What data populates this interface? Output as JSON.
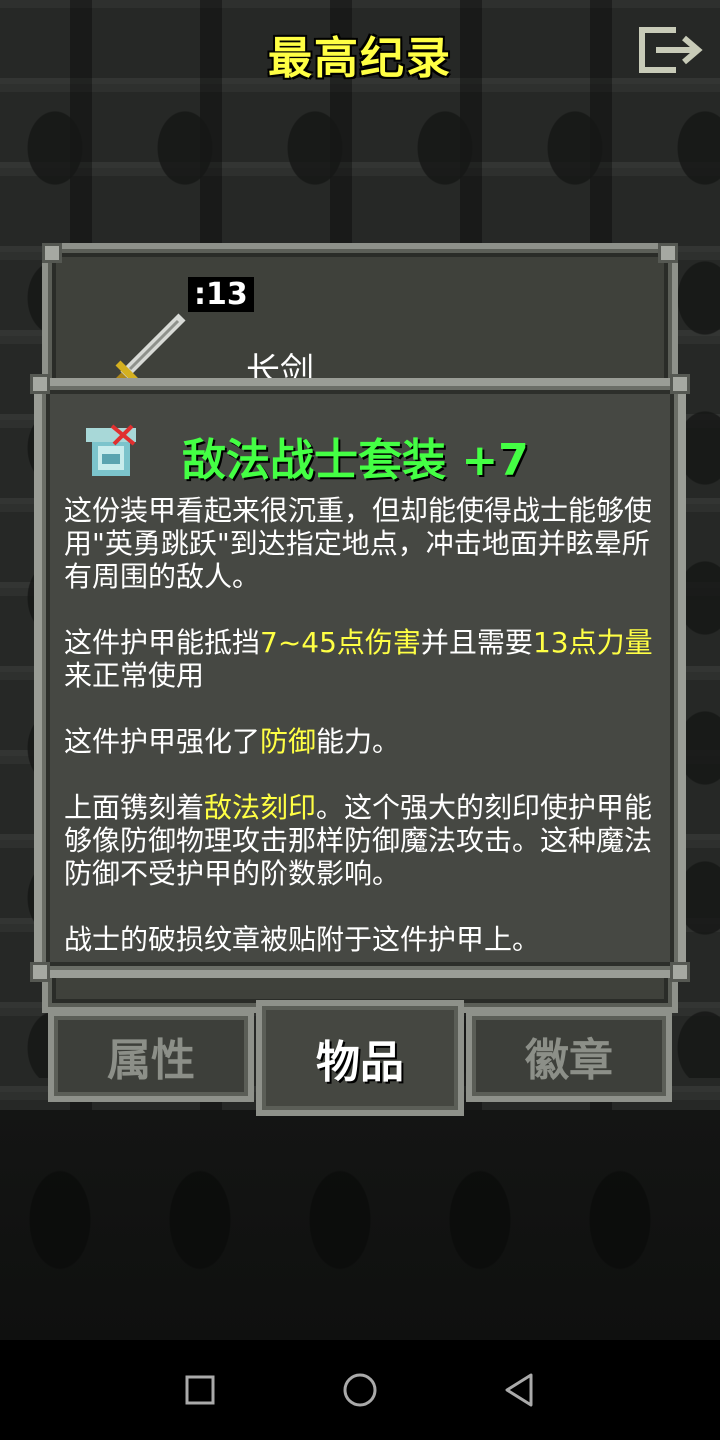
{
  "header": {
    "title": "最高纪录",
    "exit_icon": "exit-door-icon"
  },
  "item": {
    "level": ":13",
    "name": "长剑",
    "icon": "sword-icon"
  },
  "info": {
    "icon": "armor-icon",
    "title": "敌法战士套装 +7",
    "p1": "这份装甲看起来很沉重，但却能使得战士能够使用\"英勇跳跃\"到达指定地点，冲击地面并眩晕所有周围的敌人。",
    "p2_a": "这件护甲能抵挡",
    "p2_b": "7~45点伤害",
    "p2_c": "并且需要",
    "p2_d": "13点力量",
    "p2_e": "来正常使用",
    "p3_a": "这件护甲强化了",
    "p3_b": "防御",
    "p3_c": "能力。",
    "p4_a": "上面镌刻着",
    "p4_b": "敌法刻印",
    "p4_c": "。这个强大的刻印使护甲能够像防御物理攻击那样防御魔法攻击。这种魔法防御不受护甲的阶数影响。",
    "p5": "战士的破损纹章被贴附于这件护甲上。",
    "highlight_color": "#ffff44",
    "title_color": "#44ff44"
  },
  "tabs": [
    {
      "label": "属性",
      "active": false
    },
    {
      "label": "物品",
      "active": true
    },
    {
      "label": "徽章",
      "active": false
    }
  ],
  "navbar": {
    "recents_icon": "square-recents-icon",
    "home_icon": "circle-home-icon",
    "back_icon": "triangle-back-icon"
  }
}
